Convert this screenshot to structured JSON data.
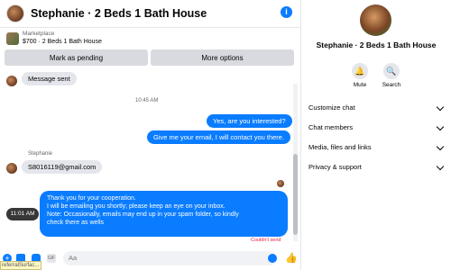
{
  "header": {
    "title": "Stephanie · 2 Beds 1 Bath House",
    "info_icon": "info-icon"
  },
  "marketplace": {
    "label": "Marketplace",
    "listing": "$700 · 2 Beds 1 Bath House"
  },
  "actions": {
    "mark_pending": "Mark as pending",
    "more_options": "More options"
  },
  "messages": {
    "sent_notice": "Message sent",
    "time_1": "10:45 AM",
    "out_1": "Yes, are you interested?",
    "out_2": "Give me your email, I will contact you there.",
    "sender_name": "Stephanie",
    "in_email": "S8016119@gmail.com",
    "long_out": [
      "Thank you for your cooperation.",
      "I will be emailing you shortly; please keep an eye on your inbox.",
      "Note: Occasionally, emails may end up in your spam folder, so kindly",
      "check there as wells"
    ],
    "hover_time": "11:01 AM",
    "failed": "Couldn't send"
  },
  "composer": {
    "placeholder": "Aa"
  },
  "status_strip": "referralSurfac...",
  "profile": {
    "name": "Stephanie · 2 Beds 1 Bath House",
    "mute_label": "Mute",
    "search_label": "Search"
  },
  "info_sections": [
    {
      "label": "Customize chat"
    },
    {
      "label": "Chat members"
    },
    {
      "label": "Media, files and links"
    },
    {
      "label": "Privacy & support"
    }
  ],
  "colors": {
    "accent": "#0a7cff",
    "bubble_in": "#e4e6eb",
    "error": "#e41e3f"
  }
}
